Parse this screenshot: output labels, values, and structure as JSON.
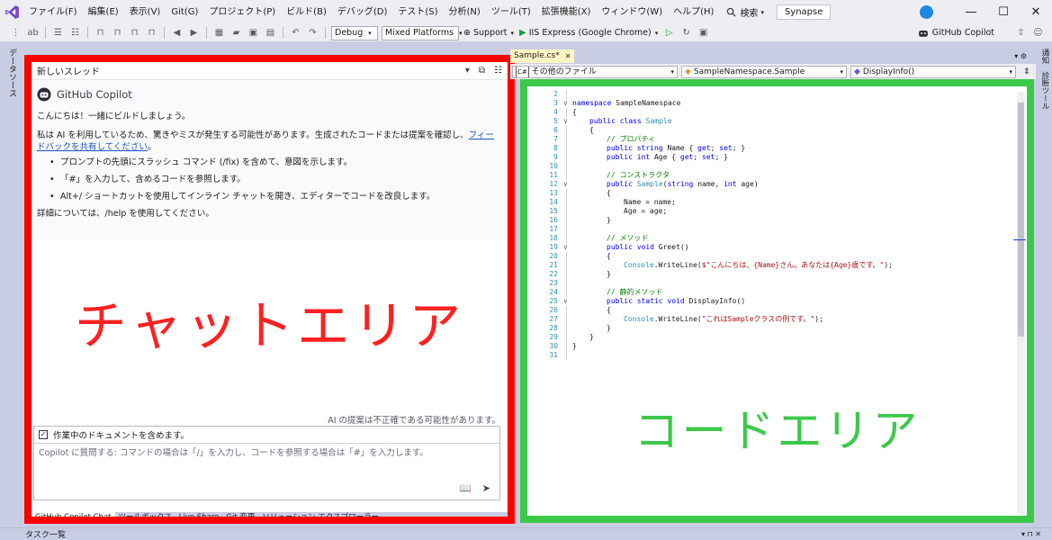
{
  "colors": {
    "chat_frame": "#ff0000",
    "code_frame": "#3cc94a",
    "accent": "#1e88e5",
    "link": "#1a55c7"
  },
  "menu": {
    "logo_icon": "visual-studio-logo-icon",
    "items": [
      "ファイル(F)",
      "編集(E)",
      "表示(V)",
      "Git(G)",
      "プロジェクト(P)",
      "ビルド(B)",
      "デバッグ(D)",
      "テスト(S)",
      "分析(N)",
      "ツール(T)",
      "拡張機能(X)",
      "ウィンドウ(W)",
      "ヘルプ(H)"
    ],
    "search_label": "検索",
    "solution_name": "Synapse"
  },
  "toolbar": {
    "config": "Debug",
    "platform": "Mixed Platforms",
    "support": "Support",
    "run_target": "IIS Express (Google Chrome)",
    "copilot_label": "GitHub Copilot"
  },
  "side": {
    "left_label": "データソース",
    "right_label": "通知　診断ツール"
  },
  "chat": {
    "header_title": "新しいスレッド",
    "copilot_title": "GitHub Copilot",
    "greeting": "こんにちは！一緒にビルドしましょう。",
    "disclaimer": "私は AI を利用しているため、驚きやミスが発生する可能性があります。生成されたコードまたは提案を確認し、",
    "feedback_link": "フィードバックを共有してください",
    "disclaimer_end": "。",
    "tips": [
      "プロンプトの先頭にスラッシュ コマンド (/fix) を含めて、意図を示します。",
      "「#」を入力して、含めるコードを参照します。",
      "Alt+/ ショートカットを使用してインライン チャットを開き、エディターでコードを改良します。"
    ],
    "help": "詳細については、/help を使用してください。",
    "area_label": "チャットエリア",
    "ai_note": "AI の提案は不正確である可能性があります。",
    "include_docs": "作業中のドキュメントを含めます。",
    "input_placeholder": "Copilot に質問する: コマンドの場合は「/」を入力し、コードを参照する場合は「#」を入力します。",
    "bottom_tabs": [
      "GitHub Copilot Chat",
      "ツールボックス",
      "Live Share",
      "Git 変更",
      "ソリューション エクスプローラー"
    ]
  },
  "editor": {
    "file_tab": "Sample.cs*",
    "nav_files": "その他のファイル",
    "nav_class": "SampleNamespace.Sample",
    "nav_member": "DisplayInfo()",
    "area_label": "コードエリア"
  },
  "code_lines": [
    {
      "n": "2",
      "f": "",
      "i": 0,
      "t": ""
    },
    {
      "n": "3",
      "f": "∨",
      "i": 0,
      "t": "<span class='kw'>namespace</span> SampleNamespace"
    },
    {
      "n": "4",
      "f": "",
      "i": 0,
      "t": "{"
    },
    {
      "n": "5",
      "f": "∨",
      "i": 1,
      "t": "<span class='kw'>public class</span> <span class='ty'>Sample</span>"
    },
    {
      "n": "6",
      "f": "",
      "i": 1,
      "t": "{"
    },
    {
      "n": "7",
      "f": "",
      "i": 2,
      "t": "<span class='cm'>// プロパティ</span>"
    },
    {
      "n": "8",
      "f": "",
      "i": 2,
      "t": "<span class='kw'>public string</span> Name { <span class='kw'>get</span>; <span class='kw'>set</span>; }"
    },
    {
      "n": "9",
      "f": "",
      "i": 2,
      "t": "<span class='kw'>public int</span> Age { <span class='kw'>get</span>; <span class='kw'>set</span>; }"
    },
    {
      "n": "10",
      "f": "",
      "i": 0,
      "t": ""
    },
    {
      "n": "11",
      "f": "",
      "i": 2,
      "t": "<span class='cm'>// コンストラクタ</span>"
    },
    {
      "n": "12",
      "f": "∨",
      "i": 2,
      "t": "<span class='kw'>public</span> <span class='ty'>Sample</span>(<span class='kw'>string</span> name, <span class='kw'>int</span> age)"
    },
    {
      "n": "13",
      "f": "",
      "i": 2,
      "t": "{"
    },
    {
      "n": "14",
      "f": "",
      "i": 3,
      "t": "Name = name;"
    },
    {
      "n": "15",
      "f": "",
      "i": 3,
      "t": "Age = age;"
    },
    {
      "n": "16",
      "f": "",
      "i": 2,
      "t": "}"
    },
    {
      "n": "17",
      "f": "",
      "i": 0,
      "t": ""
    },
    {
      "n": "18",
      "f": "",
      "i": 2,
      "t": "<span class='cm'>// メソッド</span>"
    },
    {
      "n": "19",
      "f": "∨",
      "i": 2,
      "t": "<span class='kw'>public void</span> Greet()"
    },
    {
      "n": "20",
      "f": "",
      "i": 2,
      "t": "{"
    },
    {
      "n": "21",
      "f": "",
      "i": 3,
      "t": "<span class='ty'>Console</span>.WriteLine(<span class='st'>$\"こんにちは、{Name}さん。あなたは{Age}歳です。\"</span>);"
    },
    {
      "n": "22",
      "f": "",
      "i": 2,
      "t": "}"
    },
    {
      "n": "23",
      "f": "",
      "i": 0,
      "t": ""
    },
    {
      "n": "24",
      "f": "",
      "i": 2,
      "t": "<span class='cm'>// 静的メソッド</span>"
    },
    {
      "n": "25",
      "f": "∨",
      "i": 2,
      "t": "<span class='kw'>public static void</span> DisplayInfo()"
    },
    {
      "n": "26",
      "f": "",
      "i": 2,
      "t": "{"
    },
    {
      "n": "27",
      "f": "",
      "i": 3,
      "t": "<span class='ty'>Console</span>.WriteLine(<span class='st'>\"これはSampleクラスの例です。\"</span>);"
    },
    {
      "n": "28",
      "f": "",
      "i": 2,
      "t": "}"
    },
    {
      "n": "29",
      "f": "",
      "i": 1,
      "t": "}"
    },
    {
      "n": "30",
      "f": "",
      "i": 0,
      "t": "}"
    },
    {
      "n": "31",
      "f": "",
      "i": 0,
      "t": ""
    }
  ],
  "bottom": {
    "task_list": "タスク一覧"
  }
}
